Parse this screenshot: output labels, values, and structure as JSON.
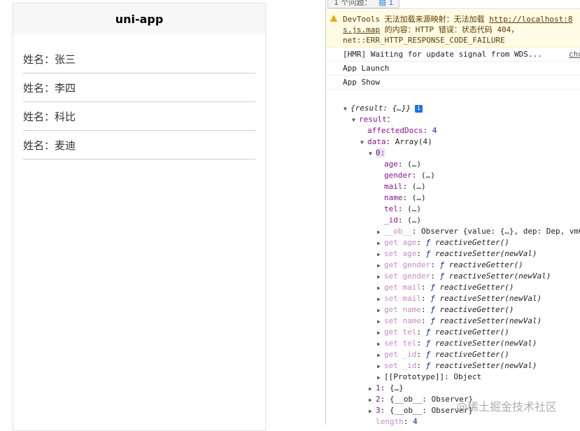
{
  "app": {
    "title": "uni-app",
    "items": [
      "姓名：张三",
      "姓名：李四",
      "姓名：科比",
      "姓名：麦迪"
    ]
  },
  "devtools": {
    "issues_label": "1 个问题：",
    "issues_count": "1",
    "warning": {
      "prefix": "DevTools 无法加载来源映射：无法加载 ",
      "link1": "http://localhost:8",
      "link2": "s.js.map",
      "line2_rest": " 的内容：HTTP 错误：状态代码 404，",
      "line3": "net::ERR_HTTP_RESPONSE_CODE_FAILURE"
    },
    "messages": [
      {
        "text": "[HMR] Waiting for update signal from WDS...",
        "source": "chu"
      },
      {
        "text": "App Launch"
      },
      {
        "text": "App Show"
      }
    ],
    "tree": [
      {
        "depth": 0,
        "arrow": "down",
        "parts": [
          [
            "it",
            "{result: {…}}"
          ]
        ],
        "info": true
      },
      {
        "depth": 1,
        "arrow": "down",
        "parts": [
          [
            "k",
            "result"
          ],
          [
            "",
            "："
          ]
        ]
      },
      {
        "depth": 2,
        "parts": [
          [
            "k",
            "affectedDocs"
          ],
          [
            "",
            ": "
          ],
          [
            "num",
            "4"
          ]
        ]
      },
      {
        "depth": 2,
        "arrow": "down",
        "parts": [
          [
            "k",
            "data"
          ],
          [
            "",
            ": Array(4)"
          ]
        ]
      },
      {
        "depth": 3,
        "arrow": "down",
        "parts": [
          [
            "k hl",
            "0:"
          ]
        ]
      },
      {
        "depth": 4,
        "parts": [
          [
            "k",
            "age"
          ],
          [
            "",
            ":  (…)"
          ]
        ]
      },
      {
        "depth": 4,
        "parts": [
          [
            "k",
            "gender"
          ],
          [
            "",
            ":  (…)"
          ]
        ]
      },
      {
        "depth": 4,
        "parts": [
          [
            "k",
            "mail"
          ],
          [
            "",
            ":  (…)"
          ]
        ]
      },
      {
        "depth": 4,
        "parts": [
          [
            "k",
            "name"
          ],
          [
            "",
            ":  (…)"
          ]
        ]
      },
      {
        "depth": 4,
        "parts": [
          [
            "k",
            "tel"
          ],
          [
            "",
            ":  (…)"
          ]
        ]
      },
      {
        "depth": 4,
        "parts": [
          [
            "k",
            "_id"
          ],
          [
            "",
            ":  (…)"
          ]
        ]
      },
      {
        "depth": 4,
        "arrow": "right",
        "parts": [
          [
            "kg",
            "__ob__"
          ],
          [
            "",
            ": Observer {value: {…}, dep: Dep, vmC"
          ]
        ]
      },
      {
        "depth": 4,
        "arrow": "right",
        "parts": [
          [
            "kg",
            "get age"
          ],
          [
            "",
            ": "
          ],
          [
            "fn",
            "ƒ "
          ],
          [
            "it",
            "reactiveGetter()"
          ]
        ]
      },
      {
        "depth": 4,
        "arrow": "right",
        "parts": [
          [
            "kg",
            "set age"
          ],
          [
            "",
            ": "
          ],
          [
            "fn",
            "ƒ "
          ],
          [
            "it",
            "reactiveSetter(newVal)"
          ]
        ]
      },
      {
        "depth": 4,
        "arrow": "right",
        "parts": [
          [
            "kg",
            "get gender"
          ],
          [
            "",
            ": "
          ],
          [
            "fn",
            "ƒ "
          ],
          [
            "it",
            "reactiveGetter()"
          ]
        ]
      },
      {
        "depth": 4,
        "arrow": "right",
        "parts": [
          [
            "kg",
            "set gender"
          ],
          [
            "",
            ": "
          ],
          [
            "fn",
            "ƒ "
          ],
          [
            "it",
            "reactiveSetter(newVal)"
          ]
        ]
      },
      {
        "depth": 4,
        "arrow": "right",
        "parts": [
          [
            "kg",
            "get mail"
          ],
          [
            "",
            ": "
          ],
          [
            "fn",
            "ƒ "
          ],
          [
            "it",
            "reactiveGetter()"
          ]
        ]
      },
      {
        "depth": 4,
        "arrow": "right",
        "parts": [
          [
            "kg",
            "set mail"
          ],
          [
            "",
            ": "
          ],
          [
            "fn",
            "ƒ "
          ],
          [
            "it",
            "reactiveSetter(newVal)"
          ]
        ]
      },
      {
        "depth": 4,
        "arrow": "right",
        "parts": [
          [
            "kg",
            "get name"
          ],
          [
            "",
            ": "
          ],
          [
            "fn",
            "ƒ "
          ],
          [
            "it",
            "reactiveGetter()"
          ]
        ]
      },
      {
        "depth": 4,
        "arrow": "right",
        "parts": [
          [
            "kg",
            "set name"
          ],
          [
            "",
            ": "
          ],
          [
            "fn",
            "ƒ "
          ],
          [
            "it",
            "reactiveSetter(newVal)"
          ]
        ]
      },
      {
        "depth": 4,
        "arrow": "right",
        "parts": [
          [
            "kg",
            "get tel"
          ],
          [
            "",
            ": "
          ],
          [
            "fn",
            "ƒ "
          ],
          [
            "it",
            "reactiveGetter()"
          ]
        ]
      },
      {
        "depth": 4,
        "arrow": "right",
        "parts": [
          [
            "kg",
            "set tel"
          ],
          [
            "",
            ": "
          ],
          [
            "fn",
            "ƒ "
          ],
          [
            "it",
            "reactiveSetter(newVal)"
          ]
        ]
      },
      {
        "depth": 4,
        "arrow": "right",
        "parts": [
          [
            "kg",
            "get _id"
          ],
          [
            "",
            ": "
          ],
          [
            "fn",
            "ƒ "
          ],
          [
            "it",
            "reactiveGetter()"
          ]
        ]
      },
      {
        "depth": 4,
        "arrow": "right",
        "parts": [
          [
            "kg",
            "set _id"
          ],
          [
            "",
            ": "
          ],
          [
            "fn",
            "ƒ "
          ],
          [
            "it",
            "reactiveSetter(newVal)"
          ]
        ]
      },
      {
        "depth": 4,
        "arrow": "right",
        "parts": [
          [
            "",
            "[[Prototype]]: Object"
          ]
        ]
      },
      {
        "depth": 3,
        "arrow": "right",
        "parts": [
          [
            "k",
            "1"
          ],
          [
            "",
            ": {…}"
          ]
        ]
      },
      {
        "depth": 3,
        "arrow": "right",
        "parts": [
          [
            "k",
            "2"
          ],
          [
            "",
            ": {__ob__: Observer}"
          ]
        ]
      },
      {
        "depth": 3,
        "arrow": "right",
        "parts": [
          [
            "k",
            "3"
          ],
          [
            "",
            ": {__ob__: Observer}"
          ]
        ]
      },
      {
        "depth": 3,
        "parts": [
          [
            "kg",
            "length"
          ],
          [
            "",
            ": "
          ],
          [
            "num",
            "4"
          ]
        ]
      }
    ]
  },
  "watermark": "@稀土掘金技术社区"
}
